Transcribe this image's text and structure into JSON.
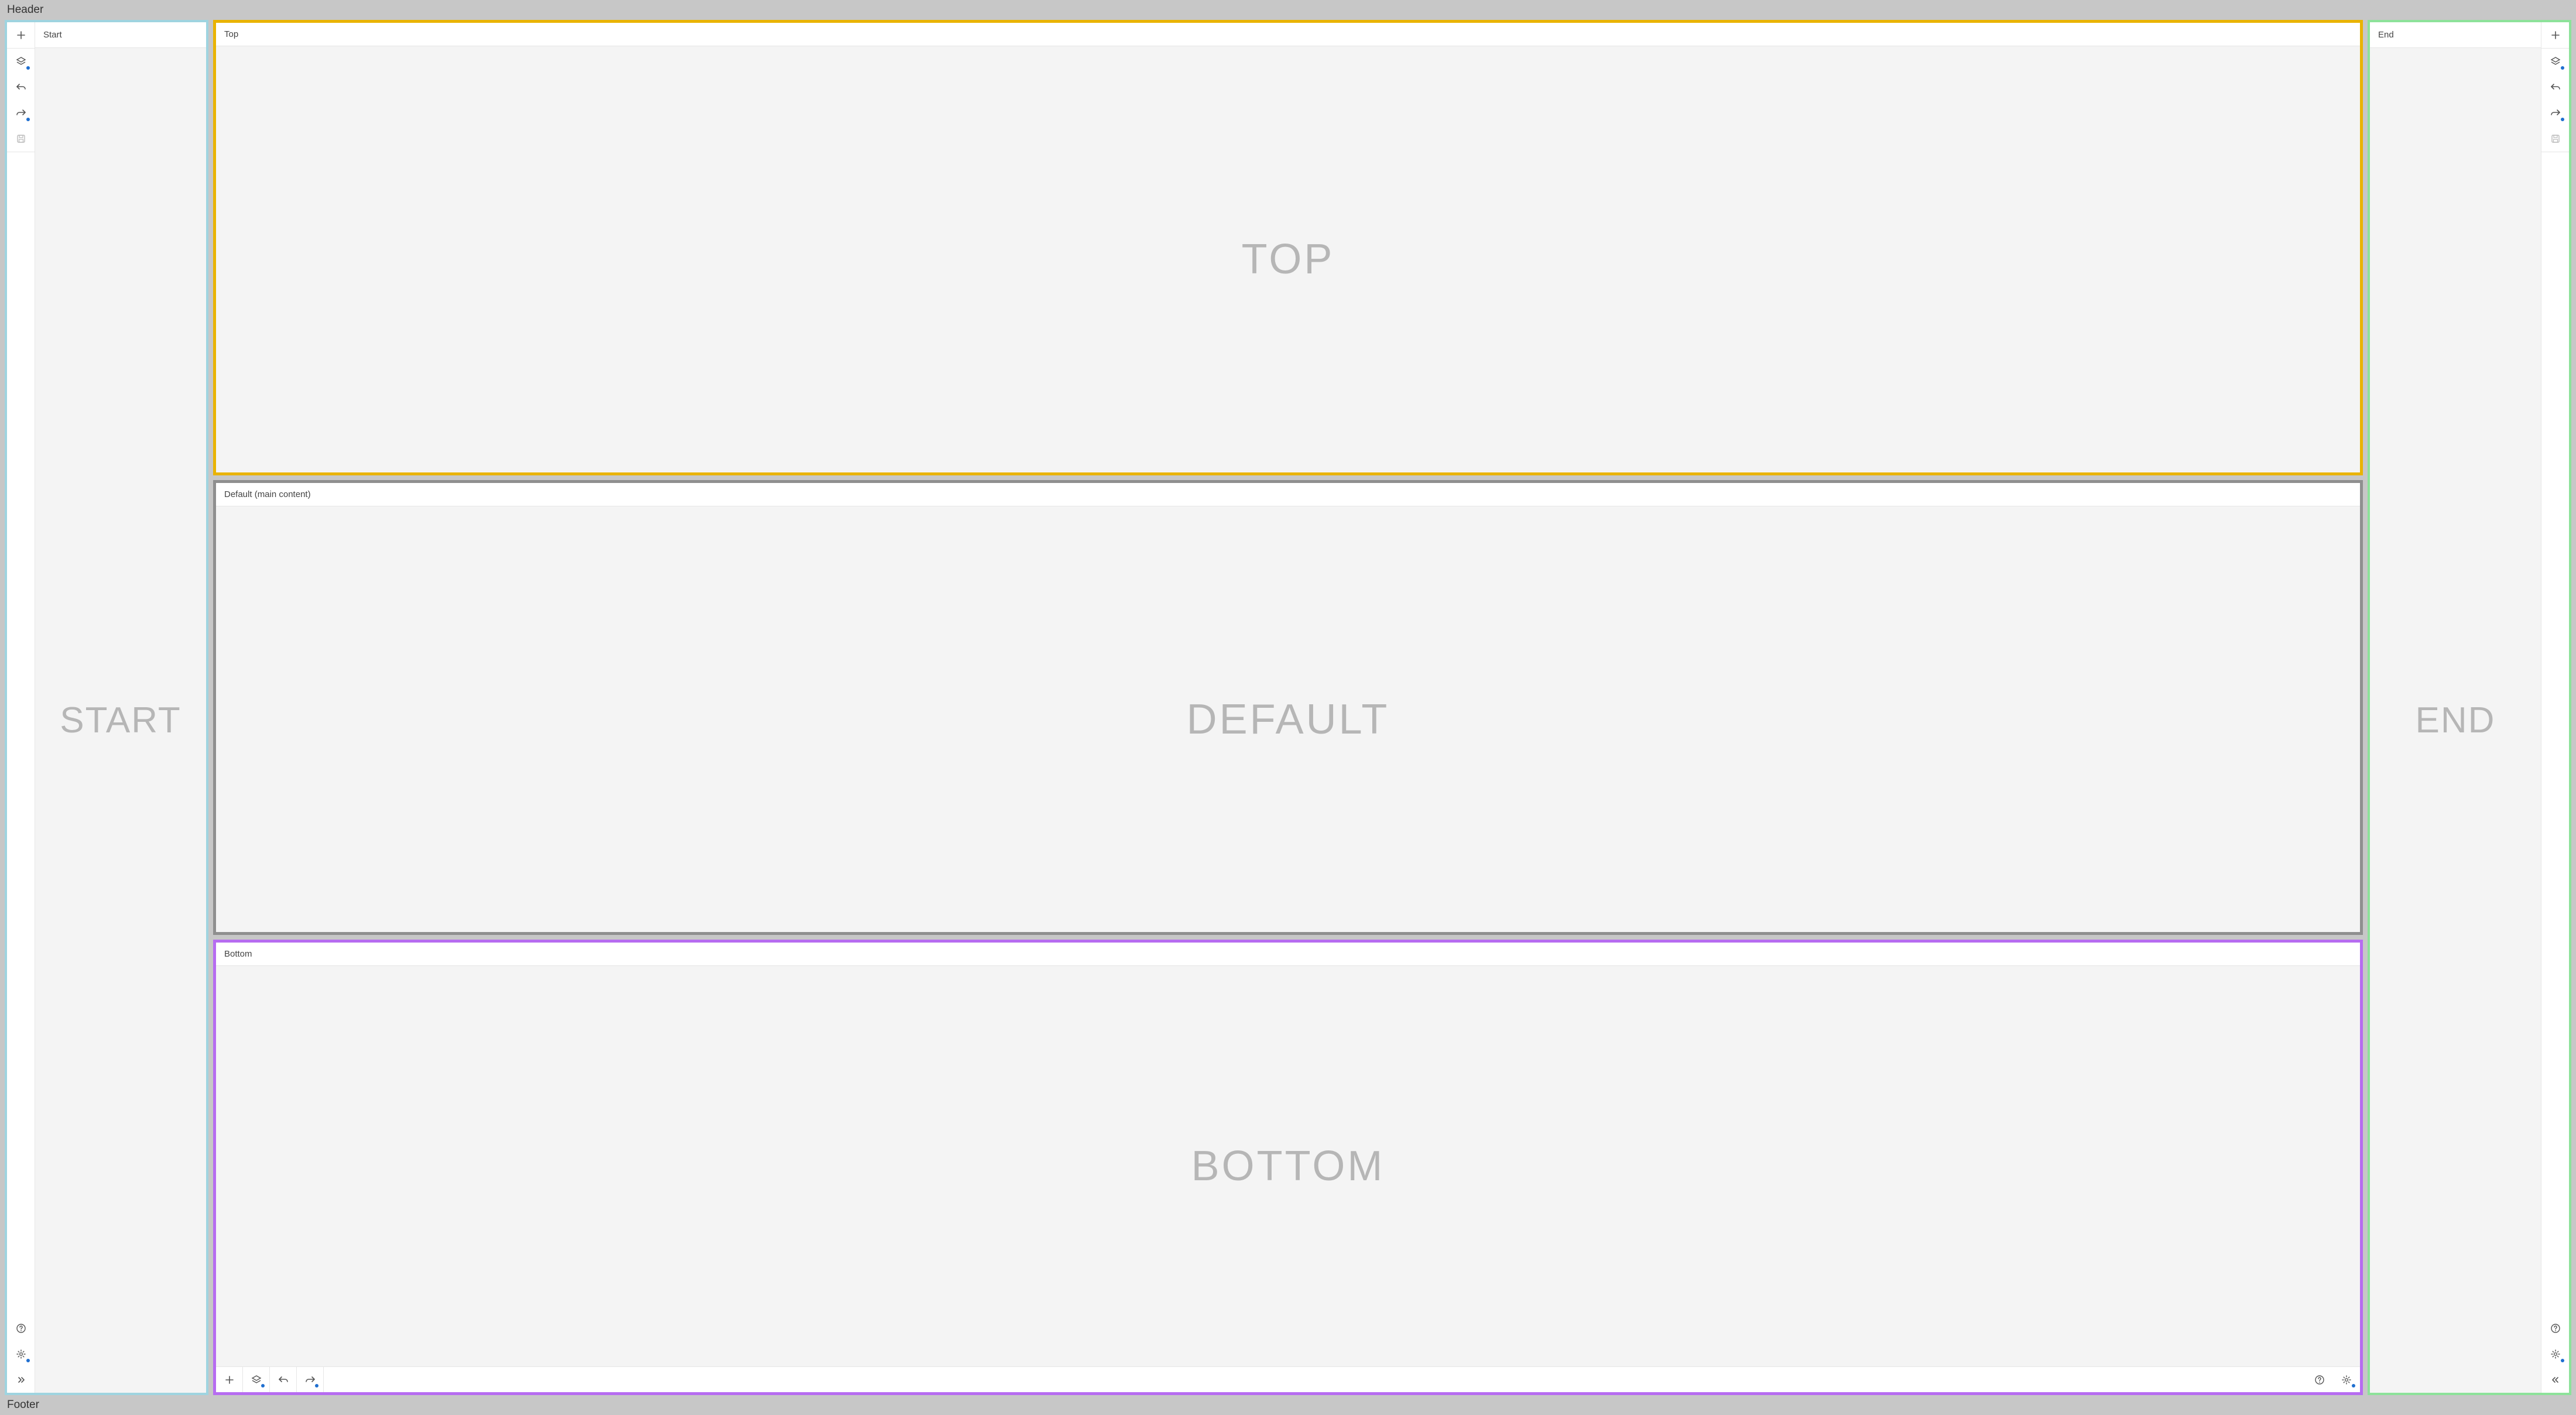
{
  "header": {
    "label": "Header"
  },
  "footer": {
    "label": "Footer"
  },
  "colors": {
    "start_border": "#9fd4e0",
    "end_border": "#8de29a",
    "top_border": "#e9b300",
    "default_border": "#8f8f8f",
    "bottom_border": "#b66cf0",
    "accent_dot": "#1f6fd0"
  },
  "start_panel": {
    "title": "Start",
    "body_text": "START",
    "rail_top": [
      "add",
      "layers",
      "undo",
      "redo",
      "save"
    ],
    "rail_bottom": [
      "help",
      "settings",
      "expand-right"
    ]
  },
  "end_panel": {
    "title": "End",
    "body_text": "END",
    "rail_top": [
      "add",
      "layers",
      "undo",
      "redo",
      "save"
    ],
    "rail_bottom": [
      "help",
      "settings",
      "expand-left"
    ]
  },
  "center": {
    "top": {
      "title": "Top",
      "body_text": "TOP"
    },
    "default": {
      "title": "Default (main content)",
      "body_text": "DEFAULT"
    },
    "bottom": {
      "title": "Bottom",
      "body_text": "BOTTOM",
      "toolbar_left": [
        "add",
        "layers",
        "undo",
        "redo"
      ],
      "toolbar_right": [
        "help",
        "settings"
      ]
    }
  }
}
